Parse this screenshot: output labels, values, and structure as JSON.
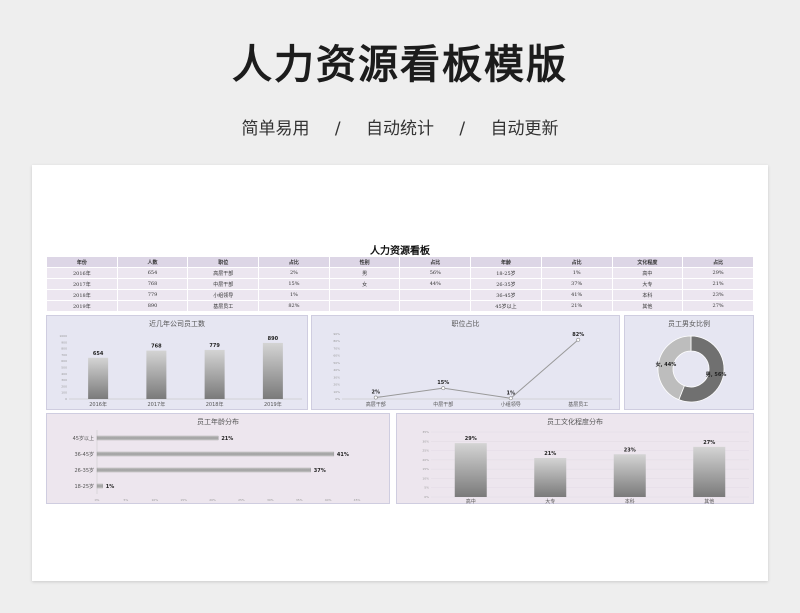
{
  "hero": {
    "title": "人力资源看板模版",
    "features": [
      "简单易用",
      "/",
      "自动统计",
      "/",
      "自动更新"
    ]
  },
  "board": {
    "title": "人力资源看板",
    "headers": [
      "年份",
      "人数",
      "职位",
      "占比",
      "性别",
      "占比",
      "年龄",
      "占比",
      "文化程度",
      "占比"
    ],
    "rows": [
      [
        "2016年",
        "654",
        "高层干部",
        "2%",
        "男",
        "56%",
        "18-25岁",
        "1%",
        "高中",
        "29%"
      ],
      [
        "2017年",
        "768",
        "中层干部",
        "15%",
        "女",
        "44%",
        "26-35岁",
        "37%",
        "大专",
        "21%"
      ],
      [
        "2018年",
        "779",
        "小组领导",
        "1%",
        "",
        "",
        "36-45岁",
        "41%",
        "本科",
        "23%"
      ],
      [
        "2019年",
        "890",
        "基层员工",
        "82%",
        "",
        "",
        "45岁以上",
        "21%",
        "其他",
        "27%"
      ]
    ]
  },
  "chart_data": [
    {
      "type": "bar",
      "title": "近几年公司员工数",
      "categories": [
        "2016年",
        "2017年",
        "2018年",
        "2019年"
      ],
      "values": [
        654,
        768,
        779,
        890
      ],
      "ylim": [
        0,
        1000
      ],
      "yticks": [
        "1000",
        "900",
        "800",
        "700",
        "600",
        "500",
        "400",
        "300",
        "200",
        "100",
        "0"
      ]
    },
    {
      "type": "line",
      "title": "职位占比",
      "categories": [
        "高层干部",
        "中层干部",
        "小组领导",
        "基层员工"
      ],
      "values": [
        2,
        15,
        1,
        82
      ],
      "labels": [
        "2%",
        "15%",
        "1%",
        "82%"
      ],
      "ylim": [
        0,
        90
      ],
      "yticks": [
        "90%",
        "80%",
        "70%",
        "60%",
        "50%",
        "40%",
        "30%",
        "20%",
        "10%",
        "0%"
      ]
    },
    {
      "type": "pie",
      "title": "员工男女比例",
      "categories": [
        "男",
        "女"
      ],
      "values": [
        56,
        44
      ],
      "labels": [
        "男, 56%",
        "女, 44%"
      ],
      "colors": [
        "#707070",
        "#bdbdbd"
      ]
    },
    {
      "type": "bar",
      "title": "员工年龄分布",
      "categories": [
        "18-25岁",
        "26-35岁",
        "36-45岁",
        "45岁以上"
      ],
      "values": [
        1,
        37,
        41,
        21
      ],
      "labels": [
        "1%",
        "37%",
        "41%",
        "21%"
      ],
      "xlim": [
        0,
        45
      ],
      "xticks": [
        "0%",
        "5%",
        "10%",
        "15%",
        "20%",
        "25%",
        "30%",
        "35%",
        "40%",
        "45%"
      ]
    },
    {
      "type": "bar",
      "title": "员工文化程度分布",
      "categories": [
        "高中",
        "大专",
        "本科",
        "其他"
      ],
      "values": [
        29,
        21,
        23,
        27
      ],
      "labels": [
        "29%",
        "21%",
        "23%",
        "27%"
      ],
      "ylim": [
        0,
        35
      ],
      "yticks": [
        "35%",
        "30%",
        "25%",
        "20%",
        "15%",
        "10%",
        "5%",
        "0%"
      ]
    }
  ]
}
